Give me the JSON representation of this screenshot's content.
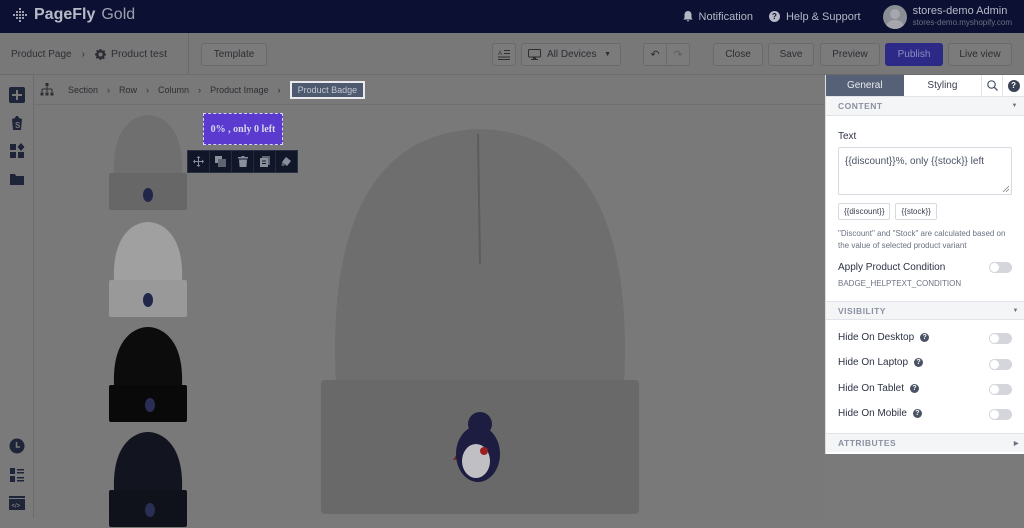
{
  "app": {
    "brand": "PageFly",
    "plan": "Gold"
  },
  "topbar": {
    "notification": "Notification",
    "help": "Help & Support",
    "user_name": "stores-demo Admin",
    "user_store": "stores-demo.myshopify.com"
  },
  "toolbar": {
    "page_type": "Product Page",
    "page_name": "Product test",
    "template": "Template",
    "device": "All Devices",
    "close": "Close",
    "save": "Save",
    "preview": "Preview",
    "publish": "Publish",
    "live_view": "Live view"
  },
  "breadcrumb": [
    "Section",
    "Row",
    "Column",
    "Product Image",
    "Product Badge"
  ],
  "badge": {
    "text": "0% , only 0 left",
    "color": "#5b3ad0"
  },
  "panel": {
    "tabs": {
      "general": "General",
      "styling": "Styling"
    },
    "content_title": "CONTENT",
    "text_label": "Text",
    "text_value": "{{discount}}%, only {{stock}} left",
    "chips": [
      "{{discount}}",
      "{{stock}}"
    ],
    "help": "\"Discount\" and \"Stock\" are calculated based on the value of selected product variant",
    "apply_condition": "Apply Product Condition",
    "condition_help": "BADGE_HELPTEXT_CONDITION",
    "visibility_title": "VISIBILITY",
    "visibility": [
      {
        "label": "Hide On Desktop",
        "on": false
      },
      {
        "label": "Hide On Laptop",
        "on": false
      },
      {
        "label": "Hide On Tablet",
        "on": false
      },
      {
        "label": "Hide On Mobile",
        "on": false
      }
    ],
    "attributes_title": "ATTRIBUTES"
  },
  "thumbnails": [
    {
      "color": "#7e7e7e"
    },
    {
      "color": "#a9a9a9"
    },
    {
      "color": "#0e0e0e"
    },
    {
      "color": "#141624"
    }
  ]
}
